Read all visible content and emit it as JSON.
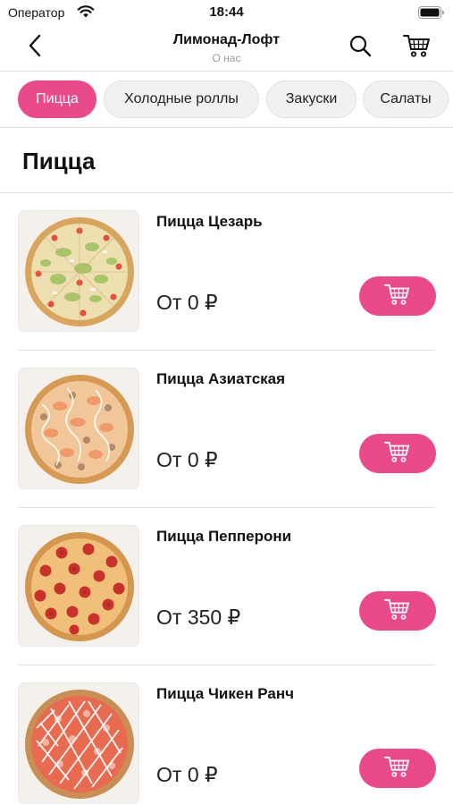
{
  "status_bar": {
    "carrier": "Оператор",
    "time": "18:44"
  },
  "header": {
    "title": "Лимонад-Лофт",
    "subtitle": "О нас"
  },
  "categories": [
    {
      "label": "Пицца",
      "active": true
    },
    {
      "label": "Холодные роллы",
      "active": false
    },
    {
      "label": "Закуски",
      "active": false
    },
    {
      "label": "Салаты",
      "active": false
    }
  ],
  "section": {
    "title": "Пицца"
  },
  "products": [
    {
      "name": "Пицца Цезарь",
      "price": "От 0 ₽",
      "image": "pizza-caesar"
    },
    {
      "name": "Пицца Азиатская",
      "price": "От 0 ₽",
      "image": "pizza-asian"
    },
    {
      "name": "Пицца Пепперони",
      "price": "От 350 ₽",
      "image": "pizza-pepperoni"
    },
    {
      "name": "Пицца Чикен Ранч",
      "price": "От 0 ₽",
      "image": "pizza-chicken-ranch"
    }
  ],
  "icons": {
    "back": "chevron-left-icon",
    "search": "search-icon",
    "cart": "cart-icon",
    "add_to_cart": "cart-icon",
    "wifi": "wifi-icon",
    "battery": "battery-icon"
  },
  "colors": {
    "accent": "#e94a8a",
    "tab_inactive_bg": "#f1f1f1",
    "divider": "#e2e2e2",
    "subtitle": "#9a9a9a"
  }
}
